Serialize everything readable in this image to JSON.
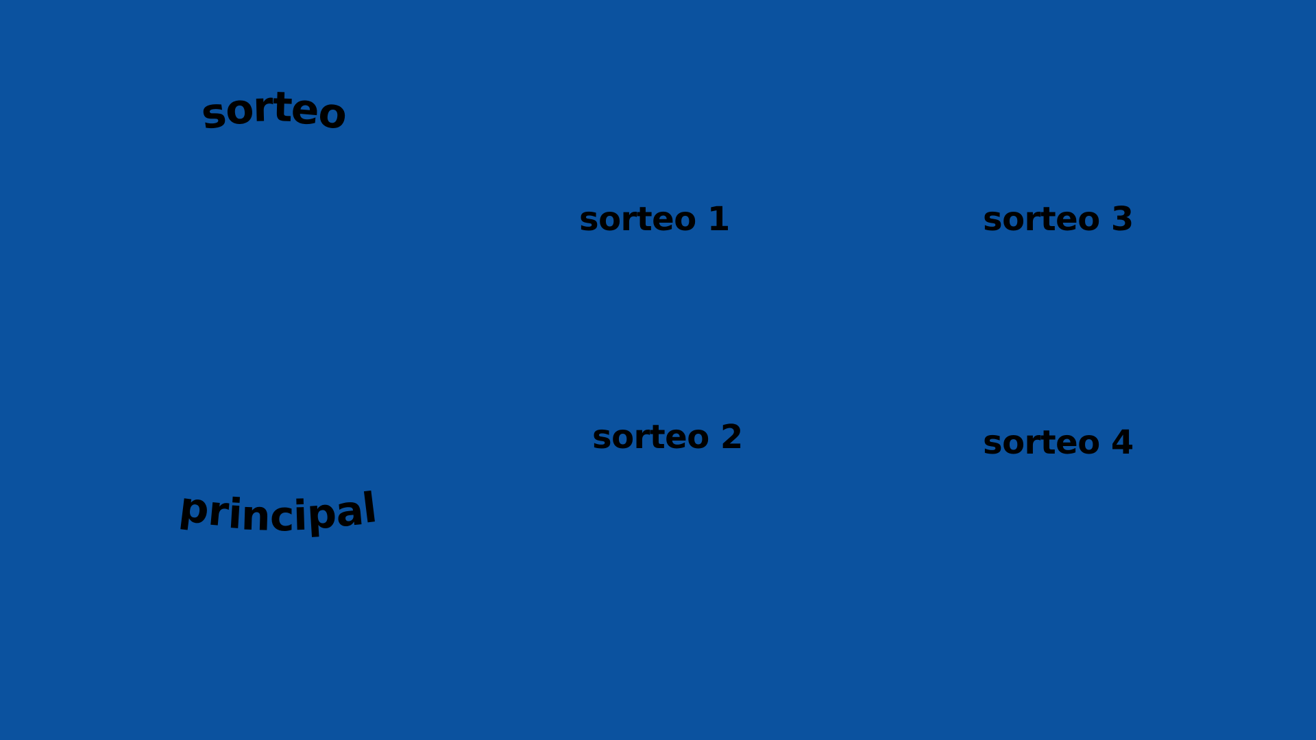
{
  "page": {
    "background_color": "#0b529f",
    "text_color": "#000000"
  },
  "title": {
    "line1": "sorteo",
    "line2": "principal"
  },
  "draws": [
    {
      "label": "sorteo 1"
    },
    {
      "label": "sorteo 2"
    },
    {
      "label": "sorteo 3"
    },
    {
      "label": "sorteo 4"
    }
  ]
}
